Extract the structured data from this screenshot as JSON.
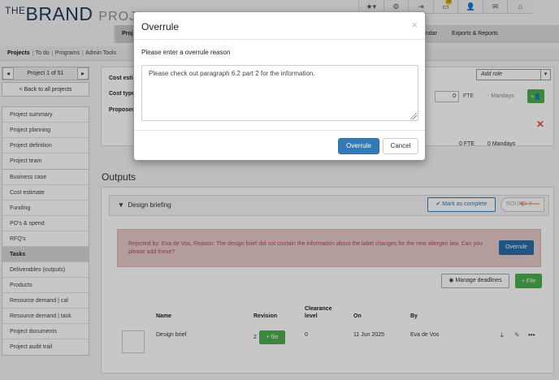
{
  "brand": {
    "prefix": "THE",
    "name": "BRAND",
    "suffix": "PROJECT"
  },
  "top_icons": [
    {
      "icon": "star-icon",
      "glyph": "★▾"
    },
    {
      "icon": "gear-icon",
      "glyph": "⚙"
    },
    {
      "icon": "sign-out-icon",
      "glyph": "⇥"
    },
    {
      "icon": "inbox-icon",
      "glyph": "▭",
      "badge": "10"
    },
    {
      "icon": "user-icon",
      "glyph": "👤"
    },
    {
      "icon": "envelope-icon",
      "glyph": "✉"
    },
    {
      "icon": "home-icon",
      "glyph": "⌂"
    }
  ],
  "main_tabs": {
    "t1": "Proj",
    "t2": "endar",
    "t3": "Exports & Reports"
  },
  "subnav": [
    "Projects",
    "To do",
    "Programs",
    "Admin Tools"
  ],
  "sidebar": {
    "pager_label": "Project 1 of 51",
    "back_label": "< Back to all projects",
    "group1": [
      "Project summary",
      "Project planning",
      "Project definition",
      "Project team"
    ],
    "group2": [
      "Business case",
      "Cost estimate",
      "Funding",
      "PO's & spend",
      "RFQ's",
      "Tasks",
      "Deliverables (outputs)",
      "Products",
      "Resource demand | cal",
      "Resource demand | task",
      "Project documents",
      "Project audit trail"
    ],
    "active": "Tasks"
  },
  "top_panel": {
    "cost_est": "Cost estir",
    "cost_type": "Cost type",
    "proposed": "Proposed",
    "add_role": "Add role",
    "fte_value": "0",
    "fte_label": "FTE",
    "mandays_label": "- Mandays",
    "total_fte": "0 FTE",
    "total_mandays": "0 Mandays"
  },
  "outputs": {
    "heading": "Outputs",
    "section_title": "Design briefing",
    "mark_complete": "Mark as complete",
    "round_label": "ROUND 7",
    "reject_message": "Rejected by: Eva de Vos, Reason: The design brief did not contain the information about the label changes for the new allergen law. Can you please add these?",
    "overrule_label": "Overrule",
    "manage_deadlines": "Manage deadlines",
    "file_btn": "+ File",
    "table": {
      "headers": {
        "name": "Name",
        "revision": "Revision",
        "clearance": "Clearance level",
        "on": "On",
        "by": "By"
      },
      "row": {
        "name": "Design brief",
        "revision": "2",
        "file_btn": "+ file",
        "clearance": "0",
        "on": "11 Jun 2025",
        "by": "Eva de Vos"
      }
    }
  },
  "modal": {
    "title": "Overrule",
    "close": "×",
    "prompt": "Please enter a overrule reason",
    "reason": "Please check out paragraph 6.2 part 2 for the information.",
    "confirm": "Overrule",
    "cancel": "Cancel"
  },
  "colors": {
    "primary": "#337ab7",
    "success": "#4cae4c",
    "danger_text": "#b94a48",
    "brand": "#23395b"
  }
}
